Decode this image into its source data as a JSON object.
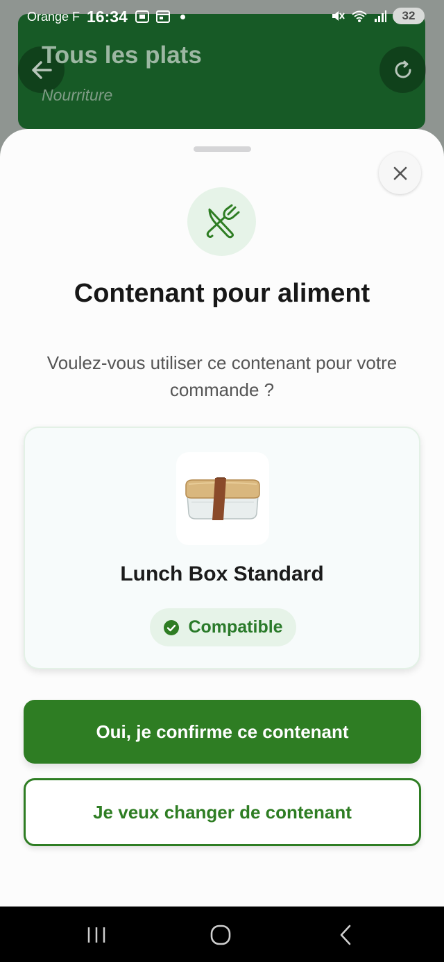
{
  "status_bar": {
    "carrier": "Orange F",
    "time": "16:34",
    "battery": "32"
  },
  "background_screen": {
    "title": "Tous les plats",
    "subtitle": "Nourriture"
  },
  "dialog": {
    "title": "Contenant pour aliment",
    "question": "Voulez-vous utiliser ce contenant pour votre commande ?",
    "container": {
      "name": "Lunch Box Standard",
      "status": "Compatible"
    },
    "confirm_label": "Oui, je confirme ce contenant",
    "change_label": "Je veux changer de contenant"
  },
  "colors": {
    "accent": "#2e7d23",
    "accent_light": "#e6f3e8",
    "header_bg": "#175a26"
  }
}
